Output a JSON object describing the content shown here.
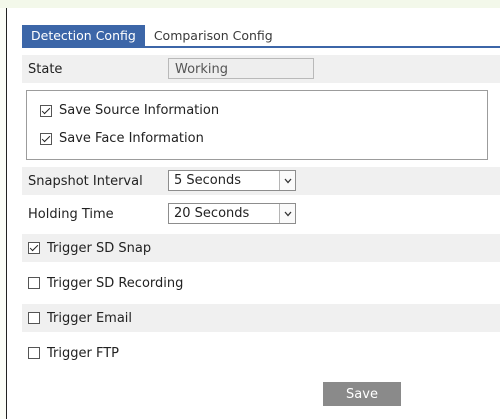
{
  "tabs": [
    {
      "label": "Detection Config",
      "active": true
    },
    {
      "label": "Comparison Config",
      "active": false
    }
  ],
  "state": {
    "label": "State",
    "value": "Working"
  },
  "info_options": [
    {
      "label": "Save Source Information",
      "checked": true
    },
    {
      "label": "Save Face Information",
      "checked": true
    }
  ],
  "snapshot_interval": {
    "label": "Snapshot Interval",
    "value": "5 Seconds"
  },
  "holding_time": {
    "label": "Holding Time",
    "value": "20 Seconds"
  },
  "triggers": [
    {
      "label": "Trigger SD Snap",
      "checked": true
    },
    {
      "label": "Trigger SD Recording",
      "checked": false
    },
    {
      "label": "Trigger Email",
      "checked": false
    },
    {
      "label": "Trigger FTP",
      "checked": false
    }
  ],
  "save_label": "Save",
  "colors": {
    "accent": "#3c66a8",
    "button": "#8a8a8a",
    "row_shade": "#f0f0f0"
  },
  "icons": {
    "dropdown": "chevron-down-icon",
    "checkbox": "checkbox-icon"
  }
}
